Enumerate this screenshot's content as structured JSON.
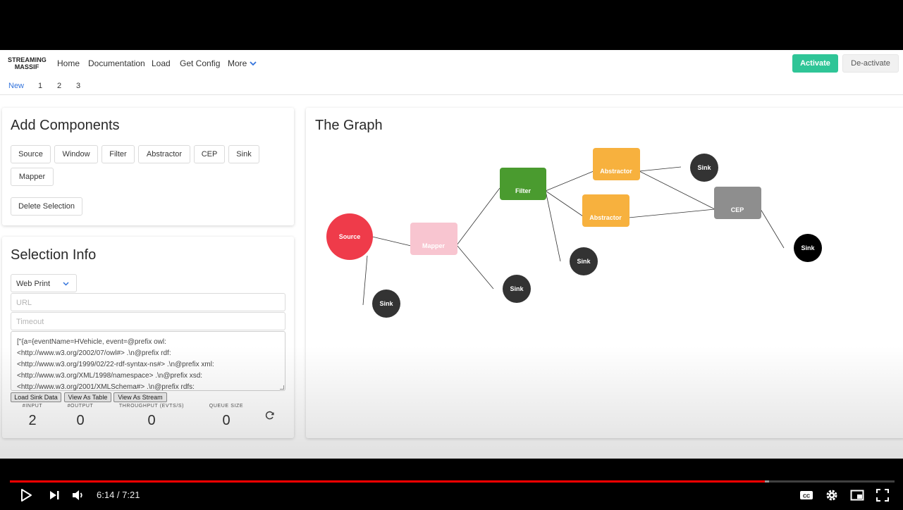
{
  "app": {
    "brand_line1": "STREAMING",
    "brand_line2": "MASSIF"
  },
  "nav": {
    "items": [
      "Home",
      "Documentation",
      "Load",
      "Get Config",
      "More"
    ],
    "activate_label": "Activate",
    "deactivate_label": "De-activate"
  },
  "tabs": [
    "New",
    "1",
    "2",
    "3"
  ],
  "add_components": {
    "title": "Add Components",
    "buttons": [
      "Source",
      "Window",
      "Filter",
      "Abstractor",
      "CEP",
      "Sink",
      "Mapper"
    ],
    "delete_label": "Delete Selection"
  },
  "selection_info": {
    "title": "Selection Info",
    "select_value": "Web Print",
    "url_placeholder": "URL",
    "timeout_placeholder": "Timeout",
    "textarea_lines": [
      "[\"{a={eventName=HVehicle, event=@prefix owl:",
      "<http://www.w3.org/2002/07/owl#> .\\n@prefix rdf:",
      "<http://www.w3.org/1999/02/22-rdf-syntax-ns#> .\\n@prefix xml:",
      "<http://www.w3.org/XML/1998/namespace> .\\n@prefix xsd:",
      "<http://www.w3.org/2001/XMLSchema#> .\\n@prefix rdfs:"
    ],
    "load_sink_label": "Load Sink Data",
    "view_table_label": "View As Table",
    "view_stream_label": "View As Stream",
    "stats": {
      "input_label": "#INPUT",
      "input_value": "2",
      "output_label": "#OUTPUT",
      "output_value": "0",
      "throughput_label": "THROUGHPUT (EVTS/S)",
      "throughput_value": "0",
      "queue_label": "QUEUE SIZE",
      "queue_value": "0"
    }
  },
  "graph": {
    "title": "The Graph",
    "nodes": [
      {
        "id": "source",
        "label": "Source",
        "shape": "circle",
        "color": "#ef3b4a"
      },
      {
        "id": "mapper",
        "label": "Mapper",
        "shape": "rect",
        "color": "#f8c5d0"
      },
      {
        "id": "filter",
        "label": "Filter",
        "shape": "rect",
        "color": "#4a9b2f"
      },
      {
        "id": "abstractor1",
        "label": "Abstractor",
        "shape": "rect",
        "color": "#f7b13e"
      },
      {
        "id": "abstractor2",
        "label": "Abstractor",
        "shape": "rect",
        "color": "#f7b13e"
      },
      {
        "id": "cep",
        "label": "CEP",
        "shape": "rect",
        "color": "#8e8e8e"
      },
      {
        "id": "sink1",
        "label": "Sink",
        "shape": "circle",
        "color": "#333333"
      },
      {
        "id": "sink2",
        "label": "Sink",
        "shape": "circle",
        "color": "#333333"
      },
      {
        "id": "sink3",
        "label": "Sink",
        "shape": "circle",
        "color": "#333333"
      },
      {
        "id": "sink4",
        "label": "Sink",
        "shape": "circle",
        "color": "#333333"
      },
      {
        "id": "sink5",
        "label": "Sink",
        "shape": "circle",
        "color": "#000000"
      }
    ]
  },
  "player": {
    "time_display": "6:14 / 7:21",
    "progress": 0.853,
    "buffered": 0.858,
    "accent_color": "#ff0000"
  }
}
